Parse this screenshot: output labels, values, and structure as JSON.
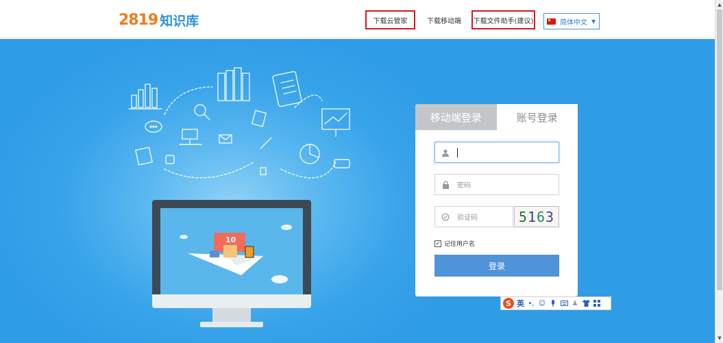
{
  "header": {
    "logo_number": "2819",
    "logo_text": "知识库",
    "links": [
      {
        "label": "下载云管家"
      },
      {
        "label": "下载移动端"
      },
      {
        "label": "下载文件助手(建议)"
      }
    ],
    "language": "简体中文"
  },
  "login": {
    "tab_mobile": "移动端登录",
    "tab_account": "账号登录",
    "username_value": "",
    "password_placeholder": "密码",
    "captcha_placeholder": "验证码",
    "captcha_text": [
      "5",
      "1",
      "6",
      "3"
    ],
    "remember_label": "记住用户名",
    "remember_checked": true,
    "submit_label": "登录"
  },
  "ime": {
    "logo": "S",
    "mode": "英"
  },
  "illustration": {
    "monitor_badge": "10"
  },
  "colors": {
    "accent": "#2e8fe6",
    "logo_orange": "#f07c1b",
    "login_button": "#4f94d9",
    "hero_blue": "#2f9ce6",
    "highlight_border": "#d9151e"
  }
}
